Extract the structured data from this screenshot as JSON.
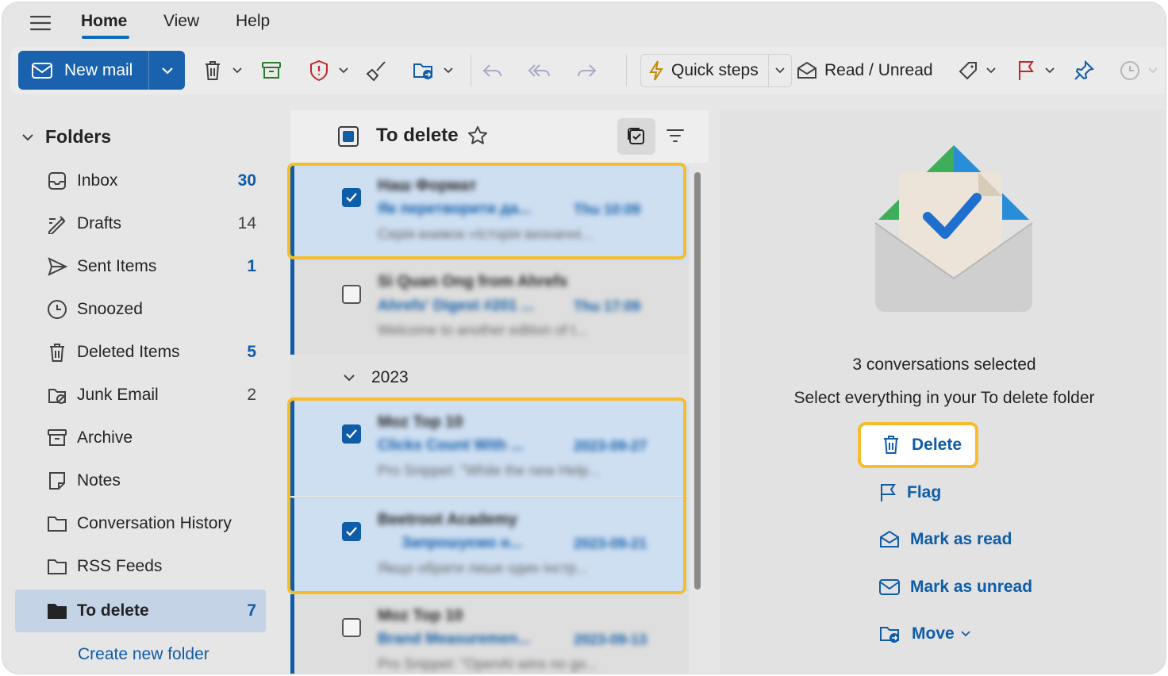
{
  "tabs": [
    "Home",
    "View",
    "Help"
  ],
  "ribbon": {
    "new_mail": "New mail",
    "quick_steps": "Quick steps",
    "read_unread": "Read / Unread"
  },
  "folders": {
    "header": "Folders",
    "items": [
      {
        "name": "Inbox",
        "count": "30",
        "icon": "inbox-icon"
      },
      {
        "name": "Drafts",
        "count": "14",
        "icon": "drafts-icon"
      },
      {
        "name": "Sent Items",
        "count": "1",
        "icon": "sent-icon"
      },
      {
        "name": "Snoozed",
        "count": "",
        "icon": "clock-icon"
      },
      {
        "name": "Deleted Items",
        "count": "5",
        "icon": "trash-icon"
      },
      {
        "name": "Junk Email",
        "count": "2",
        "icon": "junk-icon"
      },
      {
        "name": "Archive",
        "count": "",
        "icon": "archive-icon"
      },
      {
        "name": "Notes",
        "count": "",
        "icon": "note-icon"
      },
      {
        "name": "Conversation History",
        "count": "",
        "icon": "folder-icon"
      },
      {
        "name": "RSS Feeds",
        "count": "",
        "icon": "folder-icon"
      },
      {
        "name": "To delete",
        "count": "7",
        "icon": "folder-filled-icon"
      }
    ],
    "create_new": "Create new folder"
  },
  "list": {
    "title": "To delete",
    "group_label": "2023",
    "messages": [
      {
        "from": "Наш Формат",
        "subject": "Як перетворити да...",
        "date": "Thu 10:09",
        "preview": "Серія книжок «Історія визначні...",
        "checked": true
      },
      {
        "from": "Si Quan Ong from Ahrefs",
        "subject": "Ahrefs' Digest #201 ...",
        "date": "Thu 17:09",
        "preview": "Welcome to another edition of t...",
        "checked": false
      },
      {
        "from": "Moz Top 10",
        "subject": "Clicks Count With ...",
        "date": "2023-09-27",
        "preview": "Pro Snippet: \"While the new Help...",
        "checked": true
      },
      {
        "from": "Beetroot Academy",
        "subject": "Запрошуємо н...",
        "date": "2023-09-21",
        "preview": "Якщо обрати лише один інстр...",
        "checked": true
      },
      {
        "from": "Moz Top 10",
        "subject": "Brand Measuremen...",
        "date": "2023-09-13",
        "preview": "Pro Snippet: \"OpenAI wins no go...",
        "checked": false
      }
    ]
  },
  "reading": {
    "selected_count": "3 conversations selected",
    "select_all": "Select everything in your To delete folder",
    "actions": {
      "delete": "Delete",
      "flag": "Flag",
      "mark_read": "Mark as read",
      "mark_unread": "Mark as unread",
      "move": "Move"
    }
  },
  "colors": {
    "accent": "#0f5ca8",
    "highlight": "#f5bd2c",
    "brand_button": "#1a62ad"
  }
}
